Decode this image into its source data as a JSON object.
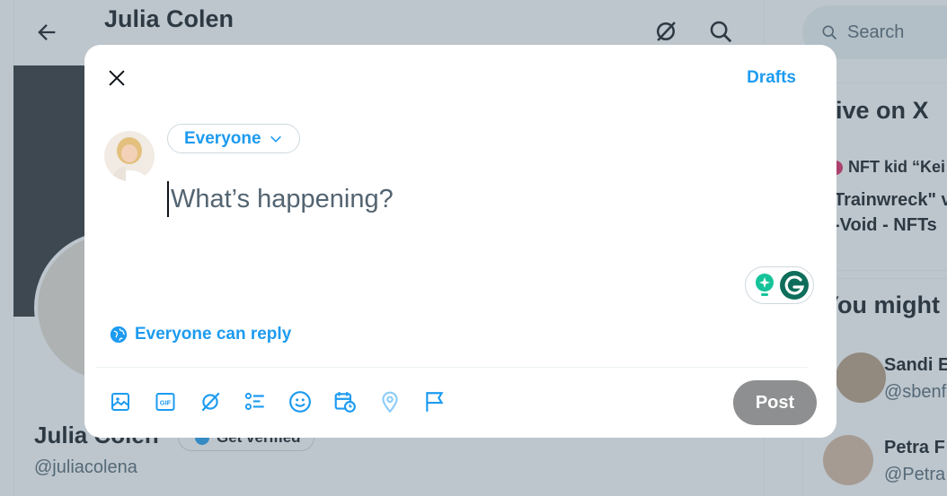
{
  "background": {
    "profile_title": "Julia Colen",
    "name": "Julia Colen",
    "verify_label": "Get verified",
    "handle": "@juliacolena",
    "search_placeholder": "Search",
    "live_heading": "ive on X",
    "trend1": "NFT kid “Kei",
    "trend2": "Trainwreck\" v",
    "trend3": "-Void - NFTs",
    "might_heading": "You might",
    "suggestions": [
      {
        "name": "Sandi E",
        "handle": "@sbenf"
      },
      {
        "name": "Petra F",
        "handle": "@Petra"
      }
    ]
  },
  "modal": {
    "drafts_label": "Drafts",
    "audience_label": "Everyone",
    "composer_placeholder": "What’s happening?",
    "composer_value": "",
    "reply_setting_label": "Everyone can reply",
    "post_label": "Post",
    "toolbar_icons": [
      "image-icon",
      "gif-icon",
      "grok-icon",
      "poll-icon",
      "emoji-icon",
      "schedule-icon",
      "location-icon",
      "flag-icon"
    ]
  },
  "colors": {
    "accent": "#1d9bf0",
    "post_disabled": "#8e8f90",
    "overlay": "rgba(91,112,131,0.4)",
    "grammarly": "#15c39a"
  }
}
